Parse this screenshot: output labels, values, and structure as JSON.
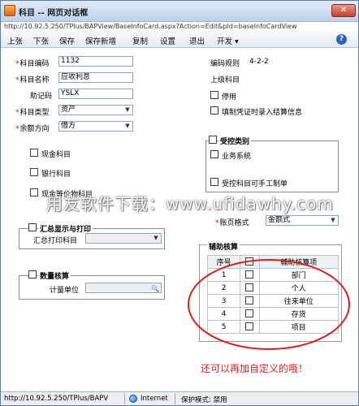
{
  "window": {
    "title": "科目 -- 网页对话框",
    "url": "http://10.92.5.250/TPlus/BAPView/BaseInfoCard.aspx?Action=Edit&pId=baseInfoCardView",
    "close_label": "✕"
  },
  "toolbar": {
    "items": [
      "上张",
      "下张",
      "保存",
      "保存新增",
      "复制",
      "设置",
      "退出",
      "开发 ▾"
    ],
    "help": "?"
  },
  "form": {
    "code_label": "科目编码",
    "code_value": "1132",
    "name_label": "科目名称",
    "name_value": "应收利息",
    "mnemonic_label": "助记码",
    "mnemonic_value": "YSLX",
    "type_label": "科目类型",
    "type_value": "资产",
    "direction_label": "余额方向",
    "direction_value": "借方",
    "coding_rule_label": "编码规则",
    "coding_rule_value": "4-2-2",
    "parent_label": "上级科目",
    "disabled_label": "停用",
    "settle_label": "填制凭证时录入结算信息",
    "cash_label": "现金科目",
    "bank_label": "银行科目",
    "cash_equiv_label": "现金等价物科目"
  },
  "controlled": {
    "title": "受控类别",
    "business_label": "业务系统",
    "manual_label": "受控科目可手工制单"
  },
  "balance_format": {
    "label": "账页格式",
    "value": "金额式"
  },
  "summary_print": {
    "title": "汇总显示与打印",
    "field_label": "汇总打印科目"
  },
  "quantity": {
    "title": "数量核算",
    "unit_label": "计量单位"
  },
  "auxiliary": {
    "title": "辅助核算",
    "headers": [
      "序号",
      "",
      "辅助核算项"
    ],
    "rows": [
      {
        "no": "1",
        "item": "部门"
      },
      {
        "no": "2",
        "item": "个人"
      },
      {
        "no": "3",
        "item": "往来单位"
      },
      {
        "no": "4",
        "item": "存货"
      },
      {
        "no": "5",
        "item": "项目"
      }
    ]
  },
  "annotation": "还可以再加自定义的哦！",
  "watermark": "用友软件下载：www.ufidawhy.com",
  "statusbar": {
    "url": "http://10.92.5.250/TPlus/BAPV",
    "zone": "Internet",
    "mode": "保护模式: 禁用"
  },
  "colors": {
    "required": "#e00000",
    "annotation": "#e02020",
    "title_bar": "#bcd2ec"
  }
}
